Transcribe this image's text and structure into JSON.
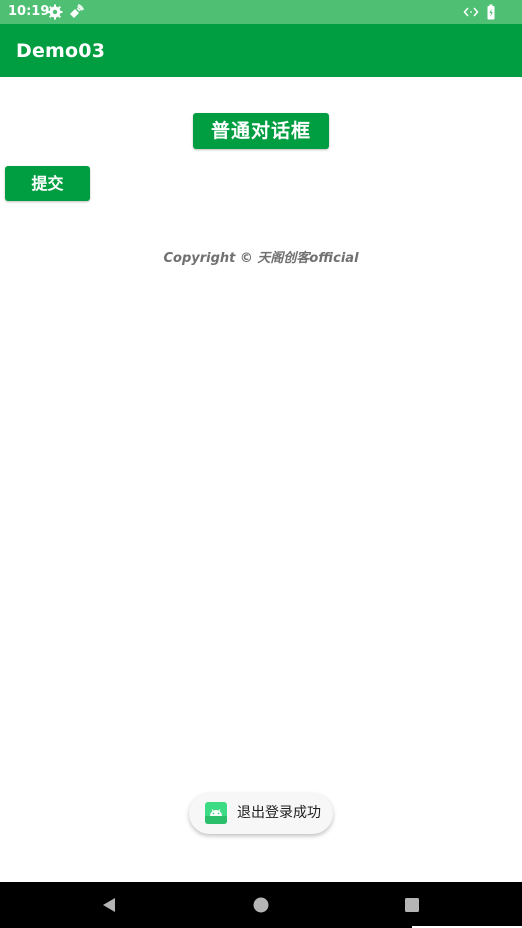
{
  "status_bar": {
    "time": "10:19",
    "left_icons": [
      "settings-icon",
      "wireless-signal-icon"
    ],
    "right_icons": [
      "code-icon",
      "battery-icon"
    ]
  },
  "app_bar": {
    "title": "Demo03"
  },
  "main": {
    "dialog_button_label": "普通对话框",
    "submit_button_label": "提交",
    "copyright": "Copyright © 天阁创客official"
  },
  "toast": {
    "icon": "android-icon",
    "message": "退出登录成功"
  },
  "navigation_bar": {
    "buttons": [
      "back-icon",
      "home-icon",
      "recents-icon"
    ]
  },
  "colors": {
    "status_bar": "#4fbf74",
    "app_bar": "#009e40",
    "button": "#009e40",
    "toast_icon": "#3ddc84"
  }
}
